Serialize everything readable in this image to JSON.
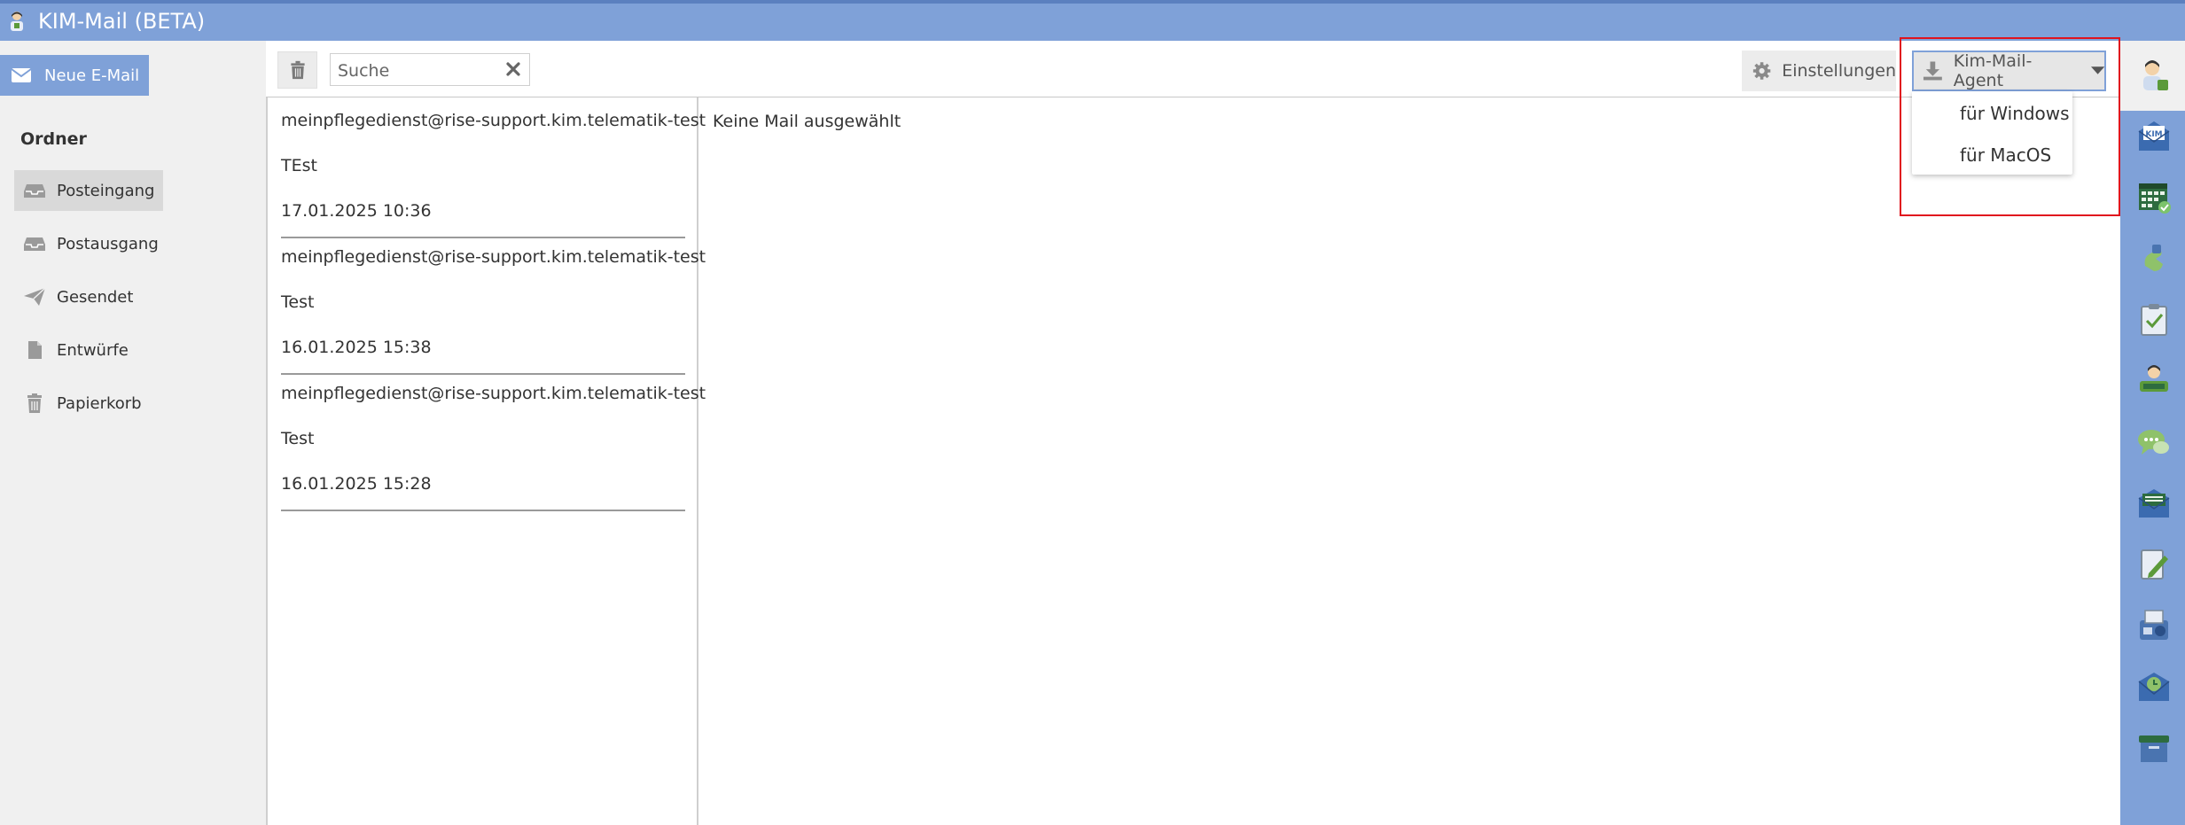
{
  "window": {
    "title": "KIM-Mail (BETA)"
  },
  "sidebar": {
    "new_mail_label": "Neue E-Mail",
    "folders_title": "Ordner",
    "folders": [
      {
        "label": "Posteingang",
        "icon": "inbox-icon",
        "active": true
      },
      {
        "label": "Postausgang",
        "icon": "outbox-icon",
        "active": false
      },
      {
        "label": "Gesendet",
        "icon": "paper-plane-icon",
        "active": false
      },
      {
        "label": "Entwürfe",
        "icon": "file-icon",
        "active": false
      },
      {
        "label": "Papierkorb",
        "icon": "trash-icon",
        "active": false
      }
    ]
  },
  "toolbar": {
    "search_placeholder": "Suche",
    "settings_label": "Einstellungen",
    "agent_label": "Kim-Mail-Agent",
    "agent_menu": [
      "für Windows",
      "für MacOS"
    ]
  },
  "mails": [
    {
      "from": "meinpflegedienst@rise-support.kim.telematik-test",
      "subject": "TEst",
      "date": "17.01.2025 10:36"
    },
    {
      "from": "meinpflegedienst@rise-support.kim.telematik-test",
      "subject": "Test",
      "date": "16.01.2025 15:38"
    },
    {
      "from": "meinpflegedienst@rise-support.kim.telematik-test",
      "subject": "Test",
      "date": "16.01.2025 15:28"
    }
  ],
  "detail": {
    "empty_text": "Keine Mail ausgewählt"
  },
  "colors": {
    "accent": "#7fa1d8",
    "highlight": "#e0141e",
    "sidebar_bg": "#f0f0f0"
  }
}
